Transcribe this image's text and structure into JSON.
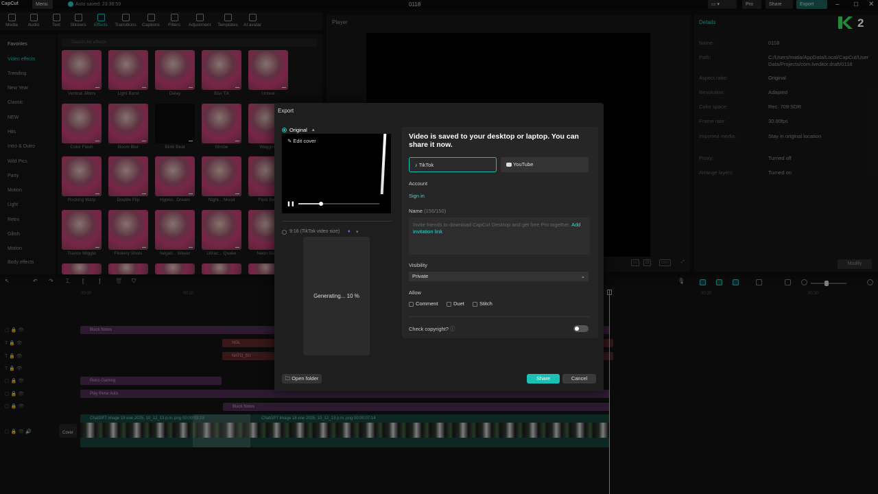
{
  "topbar": {
    "app_name": "CapCut",
    "menu_label": "Menu",
    "autosave_text": "Auto saved: 23:36:59",
    "project_title": "0118",
    "pro_label": "Pro",
    "share_label": "Share",
    "export_label": "Export"
  },
  "toolbar": {
    "tools": [
      "Media",
      "Audio",
      "Text",
      "Stickers",
      "Effects",
      "Transitions",
      "Captions",
      "Filters",
      "Adjustment",
      "Templates",
      "AI avatar"
    ]
  },
  "categories": {
    "items": [
      "Favorites",
      "Video effects",
      "Trending",
      "New Year",
      "Classic",
      "NEW",
      "Hits",
      "Intro & Outro",
      "Wild Pics",
      "Party",
      "Motion",
      "Light",
      "Retro",
      "Glitch",
      "Motion",
      "Body effects"
    ]
  },
  "effects": {
    "search_placeholder": "Search for effects",
    "labels": [
      "Vertical Jitters",
      "Light Burst",
      "Delay",
      "Blur Tilt",
      "Unreal",
      "Color Flash",
      "Boom Blur",
      "Blink Beat",
      "Strobe",
      "Wagging",
      "Rocking Warp",
      "Double Flip",
      "Hypno...Dream",
      "Night... Mood",
      "Fluid Beat",
      "Trance Wiggle",
      "Flickery Shots",
      "Negati... Waver",
      "Ultrac... Quake",
      "Neon Swi..."
    ]
  },
  "player": {
    "title": "Player"
  },
  "details": {
    "title": "Details",
    "rows": [
      {
        "k": "Name:",
        "v": "0118"
      },
      {
        "k": "Path:",
        "v": "C:/Users/matia/AppData/Local/CapCut/User Data/Projects/com.lveditor.draft/0118"
      },
      {
        "k": "Aspect ratio:",
        "v": "Original"
      },
      {
        "k": "Resolution:",
        "v": "Adapted"
      },
      {
        "k": "Color space:",
        "v": "Rec. 709 SDR"
      },
      {
        "k": "Frame rate:",
        "v": "30.00fps"
      },
      {
        "k": "Imported media:",
        "v": "Stay in original location"
      },
      {
        "k": "Proxy:",
        "v": "Turned off"
      },
      {
        "k": "Arrange layers",
        "v": "Turned on"
      }
    ],
    "modify_label": "Modify"
  },
  "timeline": {
    "ruler": [
      "00:00",
      "00:10",
      "00:20",
      "00:30"
    ],
    "clips": {
      "black_notes_1": "Black Notes",
      "red_a": "NOL",
      "red_b": "NATO_SU",
      "retro_gaming": "Retro Gaming",
      "play_pena": "Play Pena Auto",
      "black_notes_2": "Black Notes",
      "chatgpt_1": "ChatGPT Image 18 ene 2025, 10_12_13 p.m..png",
      "chatgpt_1_time": "00:00:03:23",
      "chatgpt_2": "ChatGPT Image 18 ene 2025, 10_12_13 p.m..png",
      "chatgpt_2_time": "00:00:07:14",
      "cover_label": "Cover"
    }
  },
  "export_dialog": {
    "title": "Export",
    "original_label": "Original",
    "edit_cover_label": "Edit cover",
    "tiktok_size_label": "9:16 (TikTok video size)",
    "generating_text": "Generating... 10 %",
    "saved_message": "Video is saved to your desktop or laptop. You can share it now.",
    "platforms": [
      "TikTok",
      "YouTube"
    ],
    "account_label": "Account",
    "signin_label": "Sign in",
    "name_label": "Name",
    "name_count": "(156/150)",
    "name_text": "Invite friends to download CapCut Desktop and get free Pro together.",
    "invite_link": "Add invitation link",
    "visibility_label": "Visibility",
    "visibility_value": "Private",
    "allow_label": "Allow",
    "allow_options": [
      "Comment",
      "Duet",
      "Stitch"
    ],
    "copyright_label": "Check copyright?",
    "open_folder_label": "Open folder",
    "share_label": "Share",
    "cancel_label": "Cancel",
    "preview_progress": 0.28
  },
  "colors": {
    "accent": "#1bbfb3",
    "logo_green": "#39e05a"
  }
}
